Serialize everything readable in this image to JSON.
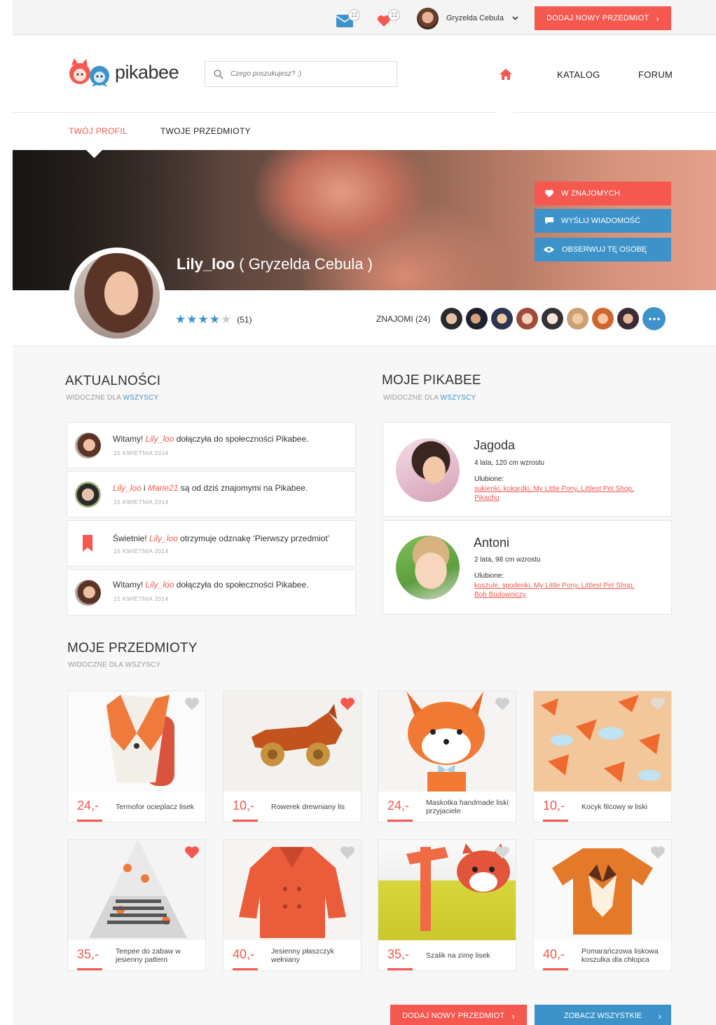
{
  "topbar": {
    "messages_count": "12",
    "likes_count": "12",
    "user_name": "Gryzelda Cebula",
    "add_button": "DODAJ NOWY PRZEDMIOT"
  },
  "header": {
    "logo_text": "pikabee",
    "search_placeholder": "Czego poszukujesz? :)",
    "nav": {
      "catalog": "KATALOG",
      "forum": "FORUM"
    }
  },
  "subnav": {
    "tab_profile": "TWÓJ PROFIL",
    "tab_items": "TWOJE PRZEDMIOTY"
  },
  "profile": {
    "username": "Lily_loo",
    "real_name": "( Gryzelda Cebula )",
    "rating_stars": 4,
    "rating_count": "(51)",
    "friends_label": "ZNAJOMI (24)",
    "actions": {
      "friends": "W ZNAJOMYCH",
      "message": "WYŚLIJ WIADOMOŚĆ",
      "follow": "OBSERWUJ TĘ OSOBĘ"
    }
  },
  "news": {
    "title": "AKTUALNOŚCI",
    "visible_prefix": "WIDOCZNE DLA",
    "visible_to": "WSZYSCY",
    "items": [
      {
        "pre": "Witamy! ",
        "user": "Lily_loo",
        "mid": "",
        "user2": "",
        "post": " dołączyła do społeczności Pikabee.",
        "date": "15 KWIETNIA 2014"
      },
      {
        "pre": "",
        "user": "Lily_loo",
        "mid": " i ",
        "user2": "Marie21",
        "post": " są od dziś znajomymi na Pikabee.",
        "date": "15 KWIETNIA 2014"
      },
      {
        "pre": "Świetnie! ",
        "user": "Lily_loo",
        "mid": "",
        "user2": "",
        "post": " otrzymuje odznakę ‘Pierwszy przedmiot’",
        "date": "15 KWIETNIA 2014"
      },
      {
        "pre": "Witamy! ",
        "user": "Lily_loo",
        "mid": "",
        "user2": "",
        "post": " dołączyła do społeczności Pikabee.",
        "date": "15 KWIETNIA 2014"
      }
    ]
  },
  "kids": {
    "title": "MOJE PIKABEE",
    "visible_prefix": "WIDOCZNE DLA",
    "visible_to": "WSZYSCY",
    "favorites_label": "Ulubione:",
    "items": [
      {
        "name": "Jagoda",
        "info": "4 lata, 120 cm wzrostu",
        "likes_line1": "sukienki, kokardki, My Little Pony, Littlest Pet Shop,",
        "likes_line2": "Pikachu"
      },
      {
        "name": "Antoni",
        "info": "2 lata, 98 cm wzrostu",
        "likes_line1": "koszule, spodenki, My Little Pony, Littlest Pet Shop,",
        "likes_line2": "Bob Budowniczy"
      }
    ]
  },
  "products": {
    "title": "MOJE PRZEDMIOTY",
    "subtitle": "WIDOCZNE DLA WSZYSCY",
    "items": [
      {
        "price": "24,-",
        "name": "Termofor ocieplacz lisek",
        "liked": false
      },
      {
        "price": "10,-",
        "name": "Rowerek drewniany lis",
        "liked": true
      },
      {
        "price": "24,-",
        "name": "Maskotka handmade liski przyjaciele",
        "liked": false
      },
      {
        "price": "10,-",
        "name": "Kocyk filcowy w liski",
        "liked": false
      },
      {
        "price": "35,-",
        "name": "Teepee do zabaw w jesienny pattern",
        "liked": true
      },
      {
        "price": "40,-",
        "name": "Jesienny płaszczyk wełniany",
        "liked": false
      },
      {
        "price": "35,-",
        "name": "Szalik na zimę lisek",
        "liked": false
      },
      {
        "price": "40,-",
        "name": "Pomarańczowa liskowa koszulka dla chłopca",
        "liked": false
      }
    ]
  },
  "footer": {
    "add_button": "DODAJ NOWY PRZEDMIOT",
    "see_all_button": "ZOBACZ WSZYSTKIE"
  },
  "colors": {
    "accent_red": "#f5584f",
    "accent_blue": "#3d93c9"
  },
  "icons": [
    "envelope-icon",
    "heart-icon",
    "chevron-down-icon",
    "chevron-right-icon",
    "search-icon",
    "home-icon",
    "star-icon",
    "more-icon",
    "comment-icon",
    "eye-icon",
    "bookmark-icon"
  ]
}
